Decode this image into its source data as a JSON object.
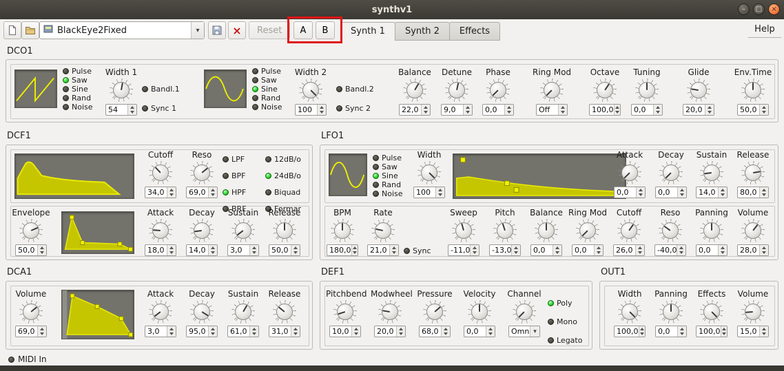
{
  "window": {
    "title": "synthv1"
  },
  "icons": {
    "minimize": "–",
    "maximize": "□",
    "close": "×",
    "delete": "×",
    "combo_arrow": "▾"
  },
  "menubar": {
    "help": "Help"
  },
  "toolbar": {
    "preset_value": "BlackEye2Fixed",
    "reset": "Reset",
    "compare_a": "A",
    "compare_b": "B",
    "tabs": [
      {
        "label": "Synth 1"
      },
      {
        "label": "Synth 2"
      },
      {
        "label": "Effects"
      }
    ]
  },
  "dco1": {
    "title": "DCO1",
    "shapes": [
      "Pulse",
      "Saw",
      "Sine",
      "Rand",
      "Noise"
    ],
    "wave1": {
      "selected": "Saw",
      "width_label": "Width 1",
      "width_value": "54",
      "band_label": "Bandl.1",
      "sync_label": "Sync 1"
    },
    "wave2": {
      "selected": "Sine",
      "width_label": "Width 2",
      "width_value": "100",
      "band_label": "Bandl.2",
      "sync_label": "Sync 2"
    },
    "knobs": [
      {
        "label": "Balance",
        "value": "22,0"
      },
      {
        "label": "Detune",
        "value": "9,0"
      },
      {
        "label": "Phase",
        "value": "0,0"
      },
      {
        "label": "Ring Mod",
        "value": "Off"
      },
      {
        "label": "Octave",
        "value": "100,0"
      },
      {
        "label": "Tuning",
        "value": "0,0"
      },
      {
        "label": "Glide",
        "value": "20,0"
      },
      {
        "label": "Env.Time",
        "value": "50,0"
      }
    ]
  },
  "dcf1": {
    "title": "DCF1",
    "cutoff": {
      "label": "Cutoff",
      "value": "34,0"
    },
    "reso": {
      "label": "Reso",
      "value": "69,0"
    },
    "types": [
      "LPF",
      "BPF",
      "HPF",
      "BRF"
    ],
    "type_selected": "HPF",
    "slopes": [
      "12dB/o",
      "24dB/o",
      "Biquad",
      "Formar"
    ],
    "slope_selected": "24dB/o",
    "envelope": {
      "label": "Envelope",
      "value": "50,0"
    },
    "adsr": [
      {
        "label": "Attack",
        "value": "18,0"
      },
      {
        "label": "Decay",
        "value": "14,0"
      },
      {
        "label": "Sustain",
        "value": "3,0"
      },
      {
        "label": "Release",
        "value": "50,0"
      }
    ]
  },
  "lfo1": {
    "title": "LFO1",
    "shapes": [
      "Pulse",
      "Saw",
      "Sine",
      "Rand",
      "Noise"
    ],
    "selected": "Sine",
    "width": {
      "label": "Width",
      "value": "100"
    },
    "adsr": [
      {
        "label": "Attack",
        "value": "0,0"
      },
      {
        "label": "Decay",
        "value": "0,0"
      },
      {
        "label": "Sustain",
        "value": "14,0"
      },
      {
        "label": "Release",
        "value": "80,0"
      }
    ],
    "bpm": {
      "label": "BPM",
      "value": "180,0"
    },
    "rate": {
      "label": "Rate",
      "value": "21,0"
    },
    "sync_label": "Sync",
    "mods": [
      {
        "label": "Sweep",
        "value": "-11,0"
      },
      {
        "label": "Pitch",
        "value": "-13,0"
      },
      {
        "label": "Balance",
        "value": "0,0"
      },
      {
        "label": "Ring Mod",
        "value": "0,0"
      },
      {
        "label": "Cutoff",
        "value": "26,0"
      },
      {
        "label": "Reso",
        "value": "-40,0"
      },
      {
        "label": "Panning",
        "value": "0,0"
      },
      {
        "label": "Volume",
        "value": "28,0"
      }
    ]
  },
  "dca1": {
    "title": "DCA1",
    "volume": {
      "label": "Volume",
      "value": "69,0"
    },
    "adsr": [
      {
        "label": "Attack",
        "value": "3,0"
      },
      {
        "label": "Decay",
        "value": "95,0"
      },
      {
        "label": "Sustain",
        "value": "61,0"
      },
      {
        "label": "Release",
        "value": "31,0"
      }
    ]
  },
  "def1": {
    "title": "DEF1",
    "knobs": [
      {
        "label": "Pitchbend",
        "value": "10,0"
      },
      {
        "label": "Modwheel",
        "value": "20,0"
      },
      {
        "label": "Pressure",
        "value": "68,0"
      },
      {
        "label": "Velocity",
        "value": "0,0"
      }
    ],
    "channel": {
      "label": "Channel",
      "value": "Omn"
    },
    "modes": [
      "Poly",
      "Mono",
      "Legato"
    ],
    "mode_selected": "Poly"
  },
  "out1": {
    "title": "OUT1",
    "knobs": [
      {
        "label": "Width",
        "value": "100,0"
      },
      {
        "label": "Panning",
        "value": "0,0"
      },
      {
        "label": "Effects",
        "value": "100,0"
      },
      {
        "label": "Volume",
        "value": "15,0"
      }
    ]
  },
  "status": {
    "midi_in": "MIDI In"
  }
}
